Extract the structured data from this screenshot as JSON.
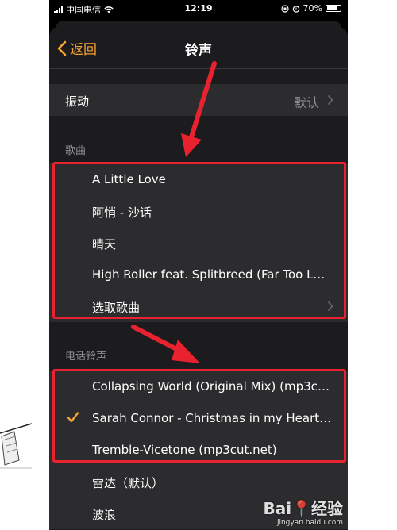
{
  "status_bar": {
    "carrier": "中国电信",
    "time": "12:19",
    "battery": "70%"
  },
  "nav": {
    "back_label": "返回",
    "title": "铃声"
  },
  "vibration": {
    "label": "振动",
    "value": "默认"
  },
  "songs": {
    "header": "歌曲",
    "items": [
      "A Little Love",
      "阿悄 - 沙话",
      "晴天",
      "High Roller feat. Splitbreed (Far Too Loud..."
    ],
    "pick_label": "选取歌曲"
  },
  "ringtones": {
    "header": "电话铃声",
    "items": [
      {
        "label": "Collapsing World (Original Mix) (mp3cut.n...",
        "selected": false
      },
      {
        "label": "Sarah Connor - Christmas in my Heart (m...",
        "selected": true
      },
      {
        "label": "Tremble-Vicetone (mp3cut.net)",
        "selected": false
      },
      {
        "label": "雷达（默认）",
        "selected": false
      },
      {
        "label": "波浪",
        "selected": false
      }
    ]
  },
  "colors": {
    "accent": "#f7a234",
    "annotation": "#e8232f",
    "background": "#1c1c1e",
    "cell": "#2c2c2e"
  },
  "watermark": {
    "main": "Bai📍经验",
    "sub": "jingyan.baidu.com"
  }
}
